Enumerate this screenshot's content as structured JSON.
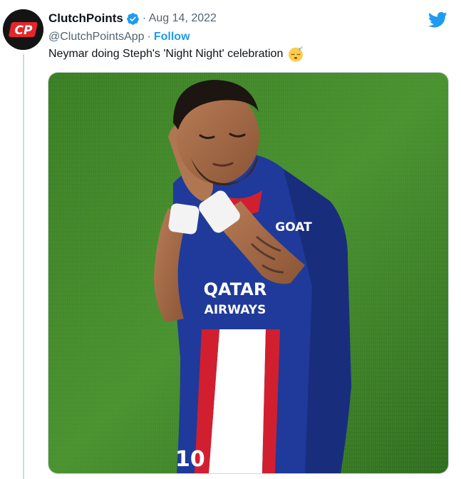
{
  "tweet": {
    "author": {
      "name": "ClutchPoints",
      "handle": "@ClutchPointsApp",
      "avatar_text": "CP"
    },
    "date": "· Aug 14, 2022",
    "separator": "·",
    "follow_label": "Follow",
    "text": "Neymar doing Steph's 'Night Night' celebration",
    "emoji": "sleeping-face-emoji",
    "media": {
      "jersey_sponsor": "QATAR AIRWAYS",
      "jersey_sponsor_line1": "QATAR",
      "jersey_sponsor_line2": "AIRWAYS",
      "jersey_brand": "GOAT",
      "jersey_number": "10"
    }
  },
  "icons": {
    "verified": "verified-badge-icon",
    "twitter": "twitter-bird-icon"
  },
  "colors": {
    "accent": "#1d9bf0",
    "secondary_text": "#536471",
    "avatar_bg": "#141414",
    "avatar_accent": "#e4262b",
    "grass": "#3f8a2a",
    "jersey": "#1f3a9a"
  }
}
